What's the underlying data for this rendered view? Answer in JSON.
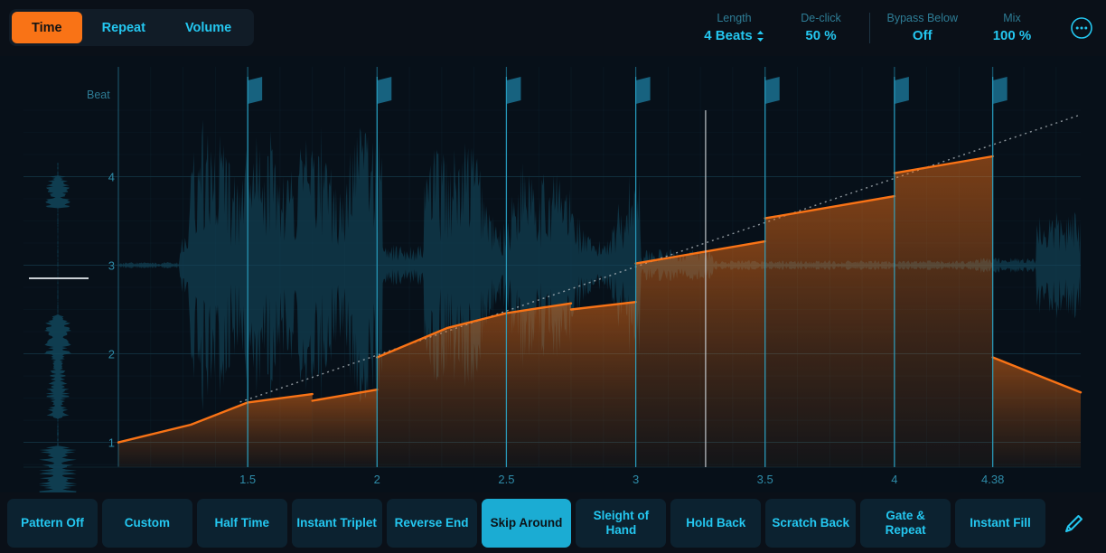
{
  "tabs": [
    {
      "label": "Time",
      "active": true
    },
    {
      "label": "Repeat",
      "active": false
    },
    {
      "label": "Volume",
      "active": false
    }
  ],
  "params": [
    {
      "label": "Length",
      "value": "4 Beats",
      "stepper": true
    },
    {
      "label": "De-click",
      "value": "50 %",
      "stepper": false
    },
    {
      "label": "Bypass Below",
      "value": "Off",
      "stepper": false
    },
    {
      "label": "Mix",
      "value": "100 %",
      "stepper": false
    }
  ],
  "more_icon": "more-circle-icon",
  "chart_axis_title": "Beat",
  "presets": [
    {
      "label": "Pattern Off",
      "active": false
    },
    {
      "label": "Custom",
      "active": false
    },
    {
      "label": "Half Time",
      "active": false
    },
    {
      "label": "Instant Triplet",
      "active": false
    },
    {
      "label": "Reverse End",
      "active": false
    },
    {
      "label": "Skip Around",
      "active": true
    },
    {
      "label": "Sleight of Hand",
      "active": false
    },
    {
      "label": "Hold Back",
      "active": false
    },
    {
      "label": "Scratch Back",
      "active": false
    },
    {
      "label": "Gate & Repeat",
      "active": false
    },
    {
      "label": "Instant Fill",
      "active": false
    }
  ],
  "edit_icon": "pencil-icon",
  "colors": {
    "accent_orange": "#f97316",
    "accent_cyan": "#24c7f0",
    "preset_active": "#1bacd3",
    "background": "#0a1018",
    "chart_background": "#071019",
    "grid": "#13303f",
    "marker": "#17627f",
    "playhead": "#c9cfd4"
  },
  "chart_data": {
    "type": "line",
    "title": "",
    "xlabel": "Beat",
    "ylabel": "Beat",
    "xlim": [
      1.0,
      4.72
    ],
    "ylim": [
      0.72,
      4.75
    ],
    "grid": true,
    "legend": null,
    "x_ticks": [
      1.5,
      2,
      2.5,
      3,
      3.5,
      4,
      4.38
    ],
    "x_ticklabels": [
      "1.5",
      "2",
      "2.5",
      "3",
      "3.5",
      "4",
      "4.38"
    ],
    "y_ticks": [
      1,
      2,
      3,
      4
    ],
    "y_ticklabels": [
      "1",
      "2",
      "3",
      "4"
    ],
    "marker_positions": [
      1.5,
      2.0,
      2.5,
      3.0,
      3.5,
      4.0,
      4.38
    ],
    "playhead_x": 3.27,
    "series": [
      {
        "name": "Reference (linear 1:1)",
        "style": "dotted",
        "color": "#b9c0c6",
        "points": [
          [
            1.47,
            1.455
          ],
          [
            4.72,
            4.7
          ]
        ]
      },
      {
        "name": "Time envelope",
        "style": "solid-filled",
        "color": "#f97316",
        "segments": [
          {
            "points": [
              [
                1.0,
                1.0
              ],
              [
                1.28,
                1.2
              ],
              [
                1.5,
                1.45
              ],
              [
                1.75,
                1.545
              ]
            ]
          },
          {
            "points": [
              [
                1.75,
                1.47
              ],
              [
                2.0,
                1.595
              ]
            ]
          },
          {
            "points": [
              [
                2.0,
                1.96
              ],
              [
                2.27,
                2.29
              ],
              [
                2.5,
                2.46
              ],
              [
                2.75,
                2.57
              ]
            ]
          },
          {
            "points": [
              [
                2.75,
                2.5
              ],
              [
                3.0,
                2.585
              ]
            ]
          },
          {
            "points": [
              [
                3.0,
                3.02
              ],
              [
                3.5,
                3.27
              ]
            ]
          },
          {
            "points": [
              [
                3.5,
                3.53
              ],
              [
                4.0,
                3.78
              ]
            ]
          },
          {
            "points": [
              [
                4.0,
                4.04
              ],
              [
                4.38,
                4.23
              ]
            ]
          },
          {
            "points": [
              [
                4.38,
                1.96
              ],
              [
                4.72,
                1.565
              ]
            ]
          }
        ]
      }
    ],
    "waveform_label": "audio waveform (background)"
  }
}
